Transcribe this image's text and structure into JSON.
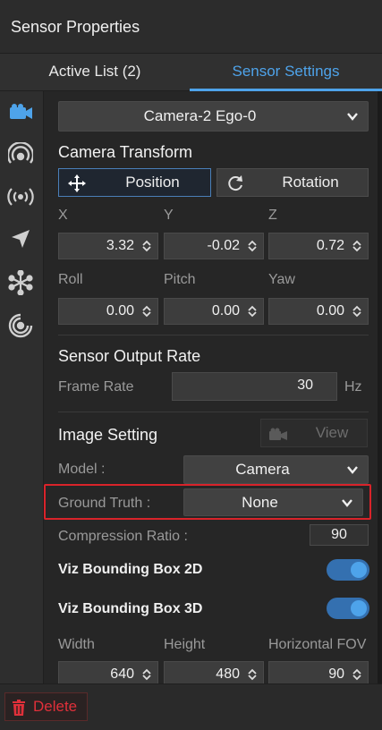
{
  "panel": {
    "title": "Sensor Properties"
  },
  "tabs": [
    {
      "label": "Active List  (2)",
      "active": false
    },
    {
      "label": "Sensor Settings",
      "active": true
    }
  ],
  "sidebar": {
    "icons": [
      "camera-icon",
      "radar-icon",
      "broadcast-icon",
      "navigation-arrow-icon",
      "lidar-icon",
      "ultrasonic-icon"
    ]
  },
  "sensor_select": {
    "value": "Camera-2   Ego-0"
  },
  "camera_transform": {
    "title": "Camera Transform",
    "position_label": "Position",
    "rotation_label": "Rotation",
    "x_label": "X",
    "y_label": "Y",
    "z_label": "Z",
    "x": "3.32",
    "y": "-0.02",
    "z": "0.72",
    "roll_label": "Roll",
    "pitch_label": "Pitch",
    "yaw_label": "Yaw",
    "roll": "0.00",
    "pitch": "0.00",
    "yaw": "0.00"
  },
  "output_rate": {
    "title": "Sensor Output Rate",
    "frame_rate_label": "Frame Rate",
    "frame_rate": "30",
    "unit": "Hz"
  },
  "image_setting": {
    "title": "Image Setting",
    "view_label": "View",
    "model_label": "Model :",
    "model_value": "Camera",
    "ground_truth_label": "Ground Truth :",
    "ground_truth_value": "None",
    "compression_label": "Compression Ratio :",
    "compression_value": "90",
    "bbox2d_label": "Viz Bounding Box 2D",
    "bbox2d_on": true,
    "bbox3d_label": "Viz Bounding Box 3D",
    "bbox3d_on": true,
    "width_label": "Width",
    "height_label": "Height",
    "hfov_label": "Horizontal FOV",
    "width_value": "640",
    "height_value": "480",
    "hfov_value": "90"
  },
  "footer": {
    "delete_label": "Delete"
  },
  "colors": {
    "accent": "#4ea3ea",
    "danger": "#e0303a",
    "highlight": "#d9232a"
  }
}
